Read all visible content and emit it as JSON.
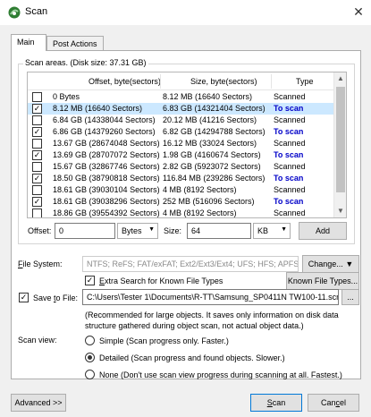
{
  "window": {
    "title": "Scan",
    "close_glyph": "✕"
  },
  "tabs": [
    {
      "label": "Main",
      "active": true
    },
    {
      "label": "Post Actions",
      "active": false
    }
  ],
  "scan_areas": {
    "label": "Scan areas. (Disk size: 37.31 GB)",
    "columns": {
      "offset": "Offset, byte(sectors)",
      "size": "Size, byte(sectors)",
      "type": "Type"
    },
    "rows": [
      {
        "checked": false,
        "offset": "0 Bytes",
        "size": "8.12 MB (16640 Sectors)",
        "type": "Scanned",
        "to_scan": false
      },
      {
        "checked": true,
        "offset": "8.12 MB (16640 Sectors)",
        "size": "6.83 GB (14321404 Sectors)",
        "type": "To scan",
        "to_scan": true
      },
      {
        "checked": false,
        "offset": "6.84 GB (14338044 Sectors)",
        "size": "20.12 MB (41216 Sectors)",
        "type": "Scanned",
        "to_scan": false
      },
      {
        "checked": true,
        "offset": "6.86 GB (14379260 Sectors)",
        "size": "6.82 GB (14294788 Sectors)",
        "type": "To scan",
        "to_scan": true
      },
      {
        "checked": false,
        "offset": "13.67 GB (28674048 Sectors)",
        "size": "16.12 MB (33024 Sectors)",
        "type": "Scanned",
        "to_scan": false
      },
      {
        "checked": true,
        "offset": "13.69 GB (28707072 Sectors)",
        "size": "1.98 GB (4160674 Sectors)",
        "type": "To scan",
        "to_scan": true
      },
      {
        "checked": false,
        "offset": "15.67 GB (32867746 Sectors)",
        "size": "2.82 GB (5923072 Sectors)",
        "type": "Scanned",
        "to_scan": false
      },
      {
        "checked": true,
        "offset": "18.50 GB (38790818 Sectors)",
        "size": "116.84 MB (239286 Sectors)",
        "type": "To scan",
        "to_scan": true
      },
      {
        "checked": false,
        "offset": "18.61 GB (39030104 Sectors)",
        "size": "4 MB (8192 Sectors)",
        "type": "Scanned",
        "to_scan": false
      },
      {
        "checked": true,
        "offset": "18.61 GB (39038296 Sectors)",
        "size": "252 MB (516096 Sectors)",
        "type": "To scan",
        "to_scan": true
      },
      {
        "checked": false,
        "offset": "18.86 GB (39554392 Sectors)",
        "size": "4 MB (8192 Sectors)",
        "type": "Scanned",
        "to_scan": false
      }
    ]
  },
  "offset_row": {
    "offset_label": "Offset:",
    "offset_value": "0",
    "offset_unit": "Bytes",
    "size_label": "Size:",
    "size_value": "64",
    "size_unit": "KB",
    "add_label": "Add"
  },
  "file_system": {
    "label": "File System:",
    "value": "NTFS; ReFS; FAT/exFAT; Ext2/Ext3/Ext4; UFS; HFS; APFS",
    "change_label": "Change...",
    "extra_search_label": "Extra Search for Known File Types",
    "extra_search_checked": true,
    "known_types_label": "Known File Types..."
  },
  "save_to_file": {
    "label": "Save to File:",
    "checked": true,
    "path": "C:\\Users\\Tester 1\\Documents\\R-TT\\Samsung_SP0411N TW100-11.scn",
    "browse_label": "...",
    "note": "(Recommended for large objects. It saves only information on disk data structure gathered during object scan, not actual object data.)"
  },
  "scan_view": {
    "label": "Scan view:",
    "options": [
      {
        "label": "Simple (Scan progress only. Faster.)",
        "selected": false
      },
      {
        "label": "Detailed (Scan progress and found objects. Slower.)",
        "selected": true
      },
      {
        "label": "None (Don't use scan view progress during scanning at all. Fastest.)",
        "selected": false
      }
    ]
  },
  "footer": {
    "advanced_label": "Advanced >>",
    "scan_label": "Scan",
    "cancel_label": "Cancel"
  }
}
